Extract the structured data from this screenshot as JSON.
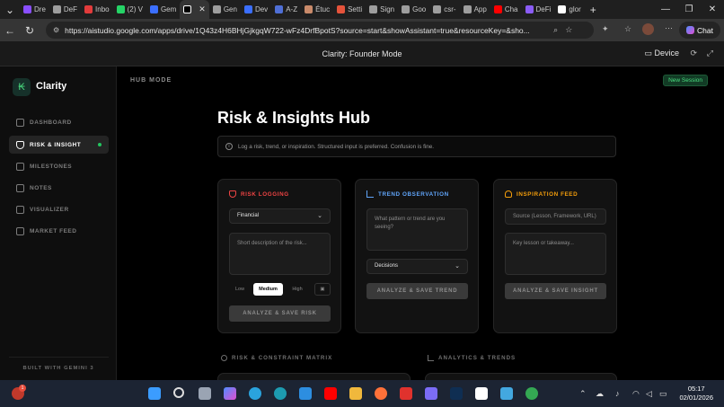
{
  "browser": {
    "tabs": [
      {
        "label": "Dre",
        "color": "#8a4fff"
      },
      {
        "label": "DeF",
        "color": "#9e9e9e"
      },
      {
        "label": "Inbo",
        "color": "#e23b3b"
      },
      {
        "label": "(2) V",
        "color": "#25d366"
      },
      {
        "label": "Gem",
        "color": "#3b6fff"
      },
      {
        "label": "",
        "color": "#000000",
        "active": true
      },
      {
        "label": "Gen",
        "color": "#9e9e9e"
      },
      {
        "label": "Dev",
        "color": "#3b6fff"
      },
      {
        "label": "A-Z",
        "color": "#4f6fd6"
      },
      {
        "label": "Étuc",
        "color": "#c98a6a"
      },
      {
        "label": "Setti",
        "color": "#e5533b"
      },
      {
        "label": "Sign",
        "color": "#9e9e9e"
      },
      {
        "label": "Goo",
        "color": "#9e9e9e"
      },
      {
        "label": "csr-",
        "color": "#9e9e9e"
      },
      {
        "label": "App",
        "color": "#9e9e9e"
      },
      {
        "label": "Cha",
        "color": "#ff0000"
      },
      {
        "label": "DeFi",
        "color": "#8b5cf6"
      },
      {
        "label": "glor",
        "color": "#ffffff"
      }
    ],
    "url": "https://aistudio.google.com/apps/drive/1Q43z4H6BHjGjkgqW722-wFz4DrfBpotS?source=start&showAssistant=true&resourceKey=&sho...",
    "chat_label": "Chat"
  },
  "app": {
    "title": "Clarity: Founder Mode",
    "device_label": "Device"
  },
  "sidebar": {
    "brand": "Clarity",
    "items": [
      {
        "label": "DASHBOARD"
      },
      {
        "label": "RISK & INSIGHT",
        "active": true
      },
      {
        "label": "MILESTONES"
      },
      {
        "label": "NOTES"
      },
      {
        "label": "VISUALIZER"
      },
      {
        "label": "MARKET FEED"
      }
    ],
    "footer": "BUILT WITH GEMINI 3"
  },
  "main": {
    "mode_label": "HUB MODE",
    "new_session": "New Session",
    "page_title": "Risk & Insights Hub",
    "hint": "Log a risk, trend, or inspiration. Structured input is preferred. Confusion is fine.",
    "risk": {
      "title": "RISK LOGGING",
      "color": "#ef4444",
      "category": "Financial",
      "placeholder": "Short description of the risk...",
      "severity": [
        "Low",
        "Medium",
        "High"
      ],
      "selected_severity": "Medium",
      "button": "ANALYZE & SAVE RISK"
    },
    "trend": {
      "title": "TREND OBSERVATION",
      "color": "#60a5fa",
      "placeholder": "What pattern or trend are you seeing?",
      "category": "Decisions",
      "button": "ANALYZE & SAVE TREND"
    },
    "inspiration": {
      "title": "INSPIRATION FEED",
      "color": "#f59e0b",
      "source_placeholder": "Source (Lesson, Framework, URL)",
      "takeaway_placeholder": "Key lesson or takeaway...",
      "button": "ANALYZE & SAVE INSIGHT"
    },
    "sections": [
      "RISK & CONSTRAINT MATRIX",
      "ANALYTICS & TRENDS"
    ]
  },
  "taskbar": {
    "time": "05:17",
    "date": "02/01/2026",
    "notification_count": "1"
  }
}
